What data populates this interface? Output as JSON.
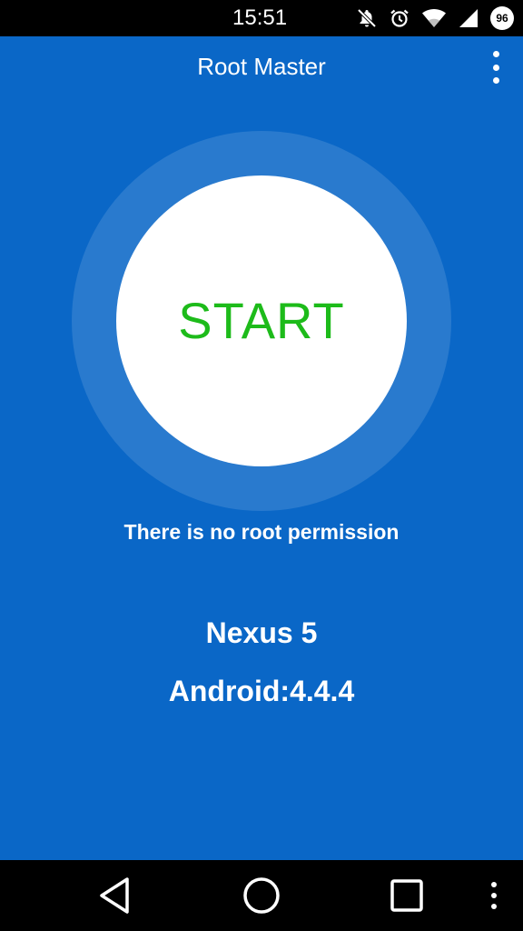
{
  "status_bar": {
    "time": "15:51",
    "battery_level": "96",
    "icons": [
      "notifications-off-icon",
      "alarm-icon",
      "wifi-icon",
      "signal-icon",
      "battery-icon"
    ]
  },
  "app_bar": {
    "title": "Root Master",
    "menu_icon": "overflow-menu-icon"
  },
  "main": {
    "start_label": "START",
    "root_status": "There is no root permission",
    "device_name": "Nexus 5",
    "android_version": "Android:4.4.4"
  },
  "nav_bar": {
    "icons": [
      "back-icon",
      "home-icon",
      "recents-icon",
      "menu-icon"
    ]
  },
  "colors": {
    "background": "#0a67c7",
    "start_text": "#1dbb1a",
    "bars": "#000000",
    "text": "#ffffff"
  }
}
